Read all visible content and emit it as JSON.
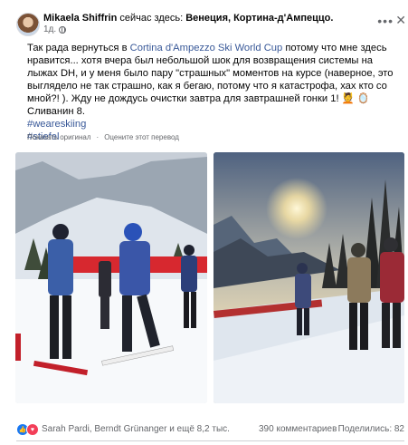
{
  "post": {
    "author": "Mikaela Shiffrin",
    "location_prefix": "сейчас здесь:",
    "location": "Венеция, Кортина-д'Ампеццо.",
    "time": "1д.",
    "icons": {
      "audience": "globe-icon",
      "more": "more-options-icon",
      "close": "close-icon"
    },
    "text_part1": "Так рада вернуться в ",
    "text_link": "Cortina d'Ampezzo Ski World Cup",
    "text_part2": " потому что мне здесь нравится... хотя вчера был небольшой шок для возвращения системы на лыжах DH, и у меня было пару \"страшных\" моментов на курсе (наверное, это выглядело не так страшно, как я бегаю, потому что я катастрофа, хах кто со мной?! ). Жду не дождусь очистки завтра для завтрашней гонки 1! 💆 🪞 Сливанин 8.",
    "hashtags": [
      "#weareskiing",
      "#stiefel"
    ],
    "show_original": "Показать оригинал",
    "separator": "·",
    "rate_translation": "Оцените этот перевод"
  },
  "photos": [
    {
      "name": "photo-skiers-on-slope",
      "alt": "Лыжники на трассе"
    },
    {
      "name": "photo-skiers-sunset",
      "alt": "Лыжники на закате"
    }
  ],
  "footer": {
    "reactions": [
      "like-icon",
      "love-icon"
    ],
    "reactors": "Sarah Pardi, Berndt Grünanger и ещё 8,2 тыс.",
    "comments": "390 комментариев",
    "shares": "Поделились: 82"
  },
  "colors": {
    "link": "#385898",
    "secondary_text": "#65676b",
    "like": "#1877f2",
    "love": "#f33e58"
  }
}
